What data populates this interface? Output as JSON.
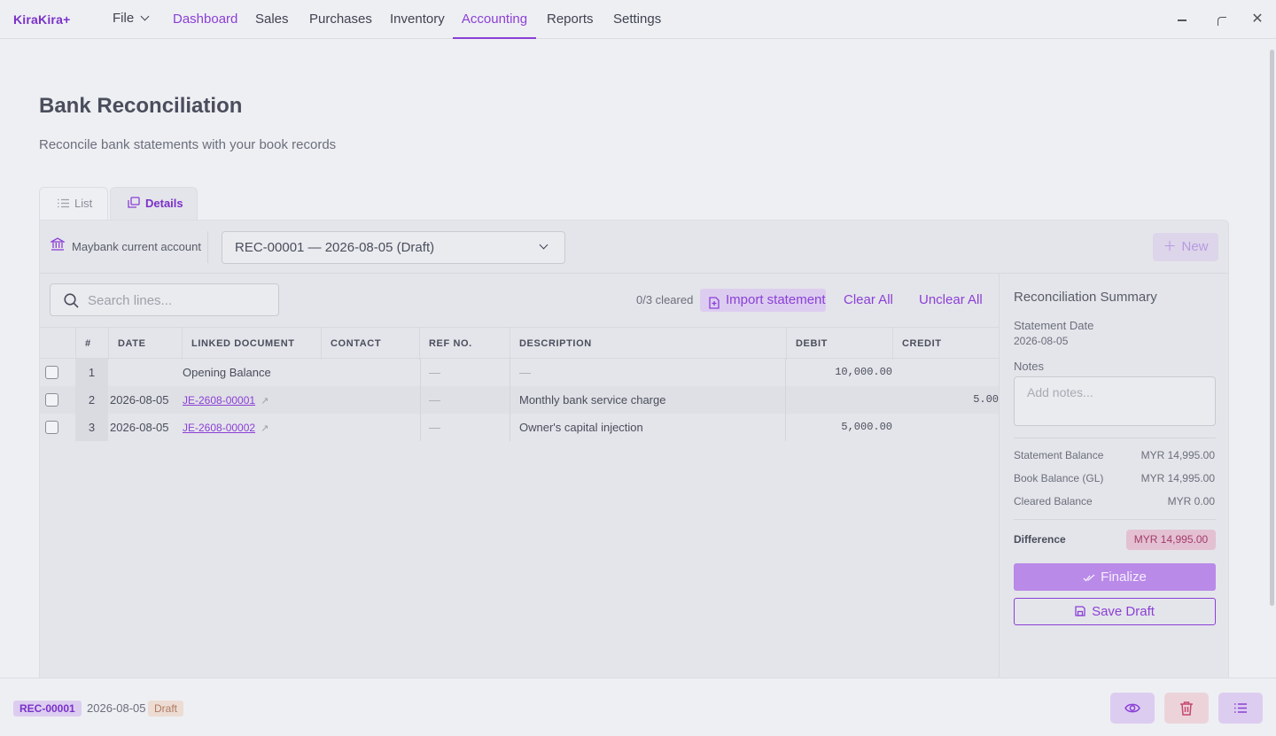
{
  "app": {
    "logo": "KiraKira+",
    "menu": {
      "file": "File"
    },
    "nav": [
      "Dashboard",
      "Sales",
      "Purchases",
      "Inventory",
      "Accounting",
      "Reports",
      "Settings"
    ],
    "active_nav": "Accounting"
  },
  "page": {
    "title": "Bank Reconciliation",
    "subtitle": "Reconcile bank statements with your book records"
  },
  "tabs": {
    "list": "List",
    "details": "Details"
  },
  "header": {
    "account": "Maybank current account",
    "reconciliation_select": "REC-00001 — 2026-08-05 (Draft)",
    "new_button": "New"
  },
  "toolbar": {
    "search_placeholder": "Search lines...",
    "cleared_count": "0/3 cleared",
    "import_button": "Import statement",
    "clear_all": "Clear All",
    "unclear_all": "Unclear All"
  },
  "table": {
    "columns": [
      "#",
      "DATE",
      "LINKED DOCUMENT",
      "CONTACT",
      "REF NO.",
      "DESCRIPTION",
      "DEBIT",
      "CREDIT"
    ],
    "rows": [
      {
        "num": "1",
        "date": "",
        "linked_document": "Opening Balance",
        "is_link": false,
        "contact": "",
        "ref_no": "—",
        "description": "—",
        "debit": "10,000.00",
        "credit": ""
      },
      {
        "num": "2",
        "date": "2026-08-05",
        "linked_document": "JE-2608-00001",
        "is_link": true,
        "contact": "",
        "ref_no": "—",
        "description": "Monthly bank service charge",
        "debit": "",
        "credit": "5.00"
      },
      {
        "num": "3",
        "date": "2026-08-05",
        "linked_document": "JE-2608-00002",
        "is_link": true,
        "contact": "",
        "ref_no": "—",
        "description": "Owner's capital injection",
        "debit": "5,000.00",
        "credit": ""
      }
    ]
  },
  "summary": {
    "title": "Reconciliation Summary",
    "statement_date_label": "Statement Date",
    "statement_date": "2026-08-05",
    "notes_label": "Notes",
    "notes_placeholder": "Add notes...",
    "statement_balance_label": "Statement Balance",
    "statement_balance": "MYR 14,995.00",
    "book_balance_label": "Book Balance (GL)",
    "book_balance": "MYR 14,995.00",
    "cleared_balance_label": "Cleared Balance",
    "cleared_balance": "MYR 0.00",
    "difference_label": "Difference",
    "difference": "MYR 14,995.00",
    "finalize_button": "Finalize",
    "save_draft_button": "Save Draft"
  },
  "footer": {
    "record_id": "REC-00001",
    "date": "2026-08-05",
    "status": "Draft"
  },
  "colors": {
    "accent": "#8b3fd6",
    "difference_badge_bg": "#e3c1d2",
    "draft_badge_bg": "#ecdcd3"
  },
  "icons": [
    "chevron-down-icon",
    "minimize-icon",
    "maximize-icon",
    "close-icon",
    "list-icon",
    "details-icon",
    "bank-icon",
    "plus-icon",
    "search-icon",
    "import-icon",
    "external-link-icon",
    "check-double-icon",
    "save-icon",
    "eye-icon",
    "trash-icon"
  ]
}
